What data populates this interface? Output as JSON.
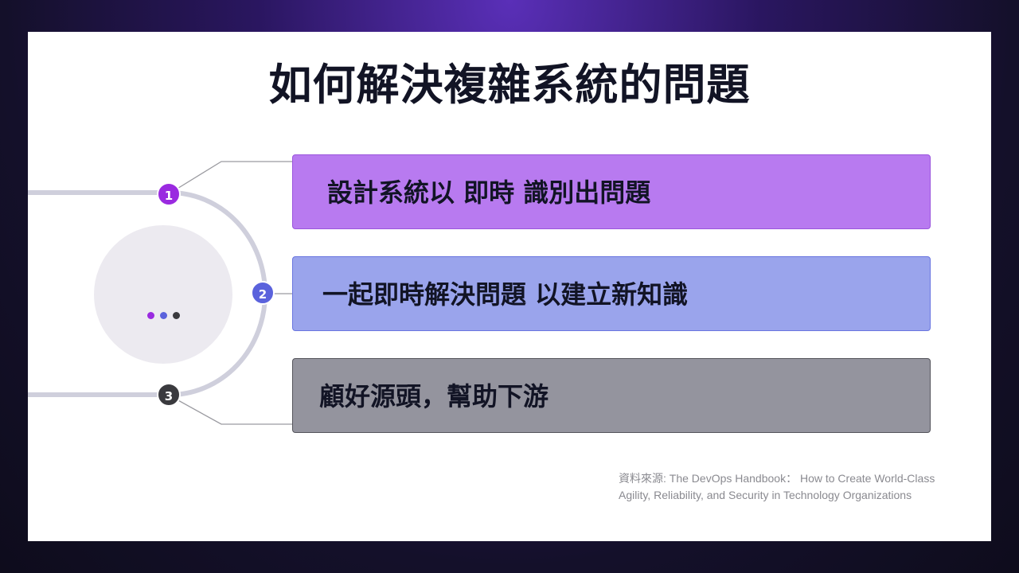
{
  "slide": {
    "title": "如何解決複雜系統的問題",
    "items": [
      {
        "number": "1",
        "text": "設計系統以 即時 識別出問題",
        "color": "#b87af0",
        "badge_color": "#9a2ae0"
      },
      {
        "number": "2",
        "text": "一起即時解決問題 以建立新知識",
        "color": "#9aa4ec",
        "badge_color": "#5a62dc"
      },
      {
        "number": "3",
        "text": "顧好源頭，幫助下游",
        "color": "#94949e",
        "badge_color": "#3a3a3e"
      }
    ],
    "source_line1": "資料來源: The DevOps Handbook：  How to Create World-Class",
    "source_line2": "Agility, Reliability, and Security in Technology Organizations",
    "dot_colors": [
      "#9a2ae0",
      "#5a62dc",
      "#3a3a3e"
    ]
  }
}
